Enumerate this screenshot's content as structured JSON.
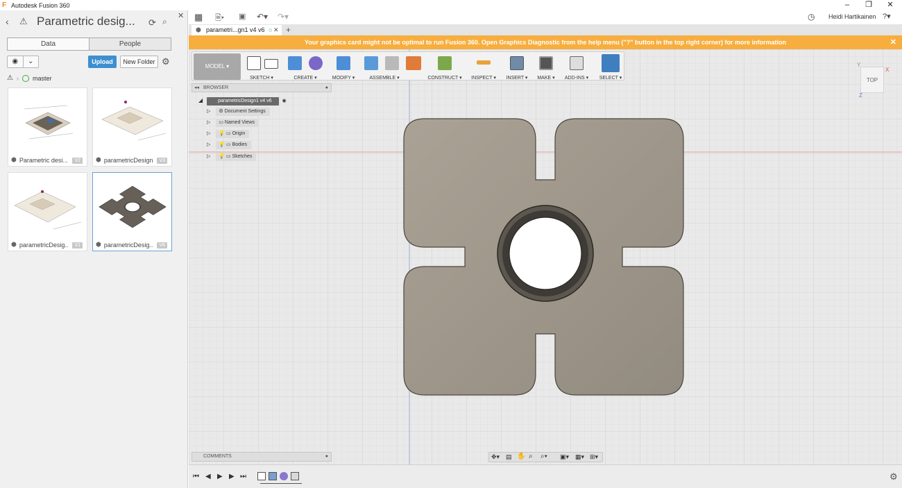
{
  "app": {
    "title": "Autodesk Fusion 360",
    "user": "Heidi Hartikainen"
  },
  "data_panel": {
    "project_title": "Parametric desig...",
    "tabs": [
      "Data",
      "People"
    ],
    "branch": "master",
    "upload_label": "Upload",
    "new_folder_label": "New Folder",
    "files": [
      {
        "name": "Parametric desi...",
        "version": "V2"
      },
      {
        "name": "parametricDesign1",
        "version": "V3"
      },
      {
        "name": "parametricDesig...",
        "version": "V1"
      },
      {
        "name": "parametricDesig...",
        "version": "V6"
      }
    ]
  },
  "document_tab": {
    "label": "parametri...gn1 v4 v6"
  },
  "banner": {
    "text": "Your graphics card might not be optimal to run Fusion 360. Open Graphics Diagnostic from the help menu (\"?\" button in the top right corner) for more information"
  },
  "toolbar": {
    "workspace": "MODEL ▾",
    "groups": [
      "SKETCH ▾",
      "CREATE ▾",
      "MODIFY ▾",
      "ASSEMBLE ▾",
      "CONSTRUCT ▾",
      "INSPECT ▾",
      "INSERT ▾",
      "MAKE ▾",
      "ADD-INS ▾",
      "SELECT ▾"
    ]
  },
  "browser": {
    "header": "BROWSER",
    "root": "parametricDesign1 v4 v6",
    "items": [
      "Document Settings",
      "Named Views",
      "Origin",
      "Bodies",
      "Sketches"
    ]
  },
  "viewcube": {
    "face": "TOP",
    "axes": [
      "Y",
      "X",
      "Z"
    ]
  },
  "comments": {
    "label": "COMMENTS"
  },
  "colors": {
    "accent": "#3c8fd0",
    "banner": "#f7ae3e",
    "part": "#9e978a"
  }
}
